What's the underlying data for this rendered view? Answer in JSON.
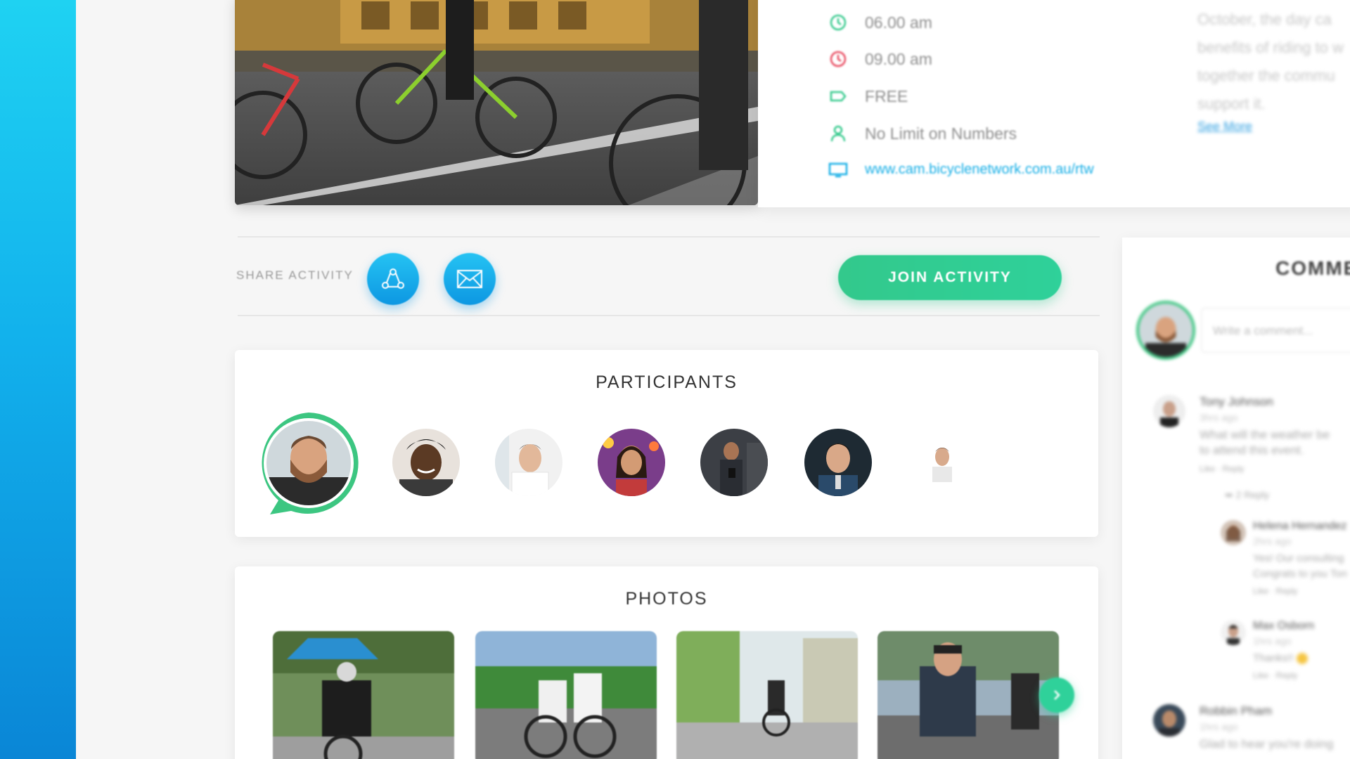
{
  "event": {
    "start_time": "06.00 am",
    "end_time": "09.00 am",
    "price": "FREE",
    "capacity": "No Limit on Numbers",
    "website": "www.cam.bicyclenetwork.com.au/rtw",
    "description_lines": [
      "October, the day ca",
      "benefits of riding to w",
      "together the commu",
      "support it."
    ],
    "see_more": "See More"
  },
  "share": {
    "label": "SHARE ACTIVITY",
    "join_label": "JOIN ACTIVITY"
  },
  "participants": {
    "title": "PARTICIPANTS"
  },
  "photos": {
    "title": "PHOTOS"
  },
  "comments": {
    "title": "COMME",
    "input_placeholder": "Write a comment...",
    "items": [
      {
        "name": "Tony Johnson",
        "time": "3hrs ago",
        "line1": "What will the weather be",
        "line2": "to attend this event.",
        "actions": "Like  ·  Reply",
        "replies_toggle": "2 Reply"
      },
      {
        "name": "Helena Hernandez",
        "time": "2hrs ago",
        "line1": "Yes! Our consulting",
        "line2": "Congrats to you Ton",
        "actions": "Like  ·  Reply"
      },
      {
        "name": "Max Osborn",
        "time": "1hrs ago",
        "line1": "Thanks!!",
        "actions": "Like  ·  Reply"
      },
      {
        "name": "Robbin Pham",
        "time": "1hrs ago",
        "line1": "Glad to hear you're doing"
      }
    ]
  },
  "colors": {
    "accent_blue": "#12b1ec",
    "accent_green": "#2fd19a"
  }
}
